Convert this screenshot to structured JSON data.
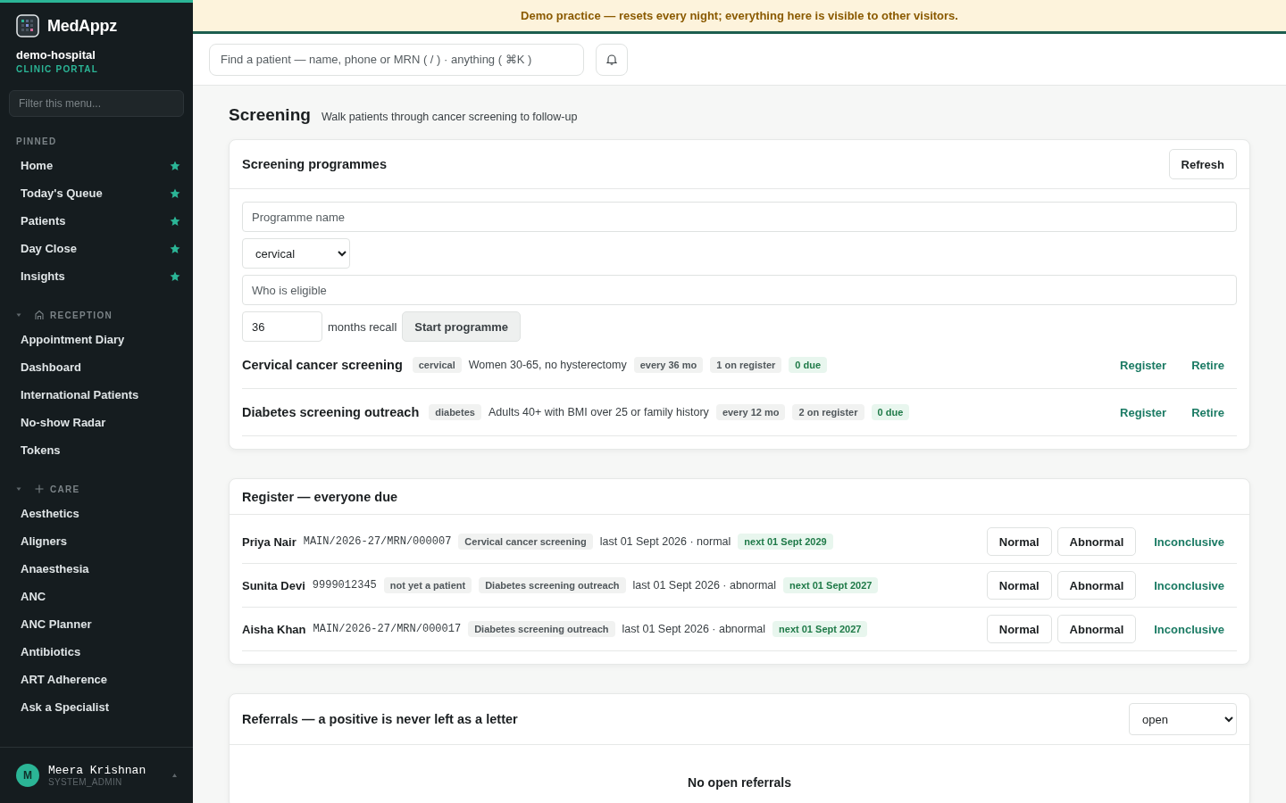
{
  "brand": {
    "name": "MedAppz",
    "org": "demo-hospital",
    "portal": "CLINIC PORTAL"
  },
  "sidebar": {
    "filter": {
      "placeholder": "Filter this menu..."
    },
    "sections": [
      {
        "title": "PINNED",
        "kind": "pinned",
        "items": [
          {
            "label": "Home",
            "pinned": true
          },
          {
            "label": "Today's Queue",
            "pinned": true
          },
          {
            "label": "Patients",
            "pinned": true
          },
          {
            "label": "Day Close",
            "pinned": true
          },
          {
            "label": "Insights",
            "pinned": true
          }
        ]
      },
      {
        "title": "RECEPTION",
        "kind": "group",
        "expanded": true,
        "items": [
          {
            "label": "Appointment Diary"
          },
          {
            "label": "Dashboard"
          },
          {
            "label": "International Patients"
          },
          {
            "label": "No-show Radar"
          },
          {
            "label": "Tokens"
          }
        ]
      },
      {
        "title": "CARE",
        "kind": "group",
        "expanded": true,
        "items": [
          {
            "label": "Aesthetics"
          },
          {
            "label": "Aligners"
          },
          {
            "label": "Anaesthesia"
          },
          {
            "label": "ANC"
          },
          {
            "label": "ANC Planner"
          },
          {
            "label": "Antibiotics"
          },
          {
            "label": "ART Adherence"
          },
          {
            "label": "Ask a Specialist"
          }
        ]
      }
    ]
  },
  "user": {
    "initial": "M",
    "name": "Meera Krishnan",
    "role": "SYSTEM_ADMIN"
  },
  "banner": "Demo practice — resets every night; everything here is visible to other visitors.",
  "search": {
    "placeholder": "Find a patient — name, phone or MRN ( / ) · anything ( ⌘K )"
  },
  "page": {
    "title": "Screening",
    "subtitle": "Walk patients through cancer screening to follow-up"
  },
  "programmes_card": {
    "title": "Screening programmes",
    "refresh_button": "Refresh",
    "form": {
      "name_placeholder": "Programme name",
      "type_value": "cervical",
      "eligible_placeholder": "Who is eligible",
      "recall_value": "36",
      "recall_unit": "months recall",
      "start_button": "Start programme"
    },
    "programmes": [
      {
        "name": "Cervical cancer screening",
        "type": "cervical",
        "eligibility": "Women 30-65, no hysterectomy",
        "recall": "every 36 mo",
        "register": "1 on register",
        "due": "0 due",
        "actions": [
          "Register",
          "Retire"
        ]
      },
      {
        "name": "Diabetes screening outreach",
        "type": "diabetes",
        "eligibility": "Adults 40+ with BMI over 25 or family history",
        "recall": "every 12 mo",
        "register": "2 on register",
        "due": "0 due",
        "actions": [
          "Register",
          "Retire"
        ]
      }
    ]
  },
  "register_card": {
    "title": "Register — everyone due",
    "rows": [
      {
        "name": "Priya Nair",
        "id": "MAIN/2026-27/MRN/000007",
        "programme": "Cervical cancer screening",
        "last": "last 01 Sept 2026 · normal",
        "next": "next 01 Sept 2029",
        "buttons": [
          "Normal",
          "Abnormal"
        ],
        "link": "Inconclusive"
      },
      {
        "name": "Sunita Devi",
        "id": "9999012345",
        "status": "not yet a patient",
        "programme": "Diabetes screening outreach",
        "last": "last 01 Sept 2026 · abnormal",
        "next": "next 01 Sept 2027",
        "buttons": [
          "Normal",
          "Abnormal"
        ],
        "link": "Inconclusive"
      },
      {
        "name": "Aisha Khan",
        "id": "MAIN/2026-27/MRN/000017",
        "programme": "Diabetes screening outreach",
        "last": "last 01 Sept 2026 · abnormal",
        "next": "next 01 Sept 2027",
        "buttons": [
          "Normal",
          "Abnormal"
        ],
        "link": "Inconclusive"
      }
    ]
  },
  "referrals_card": {
    "title": "Referrals — a positive is never left as a letter",
    "filter_value": "open",
    "empty": "No open referrals"
  }
}
